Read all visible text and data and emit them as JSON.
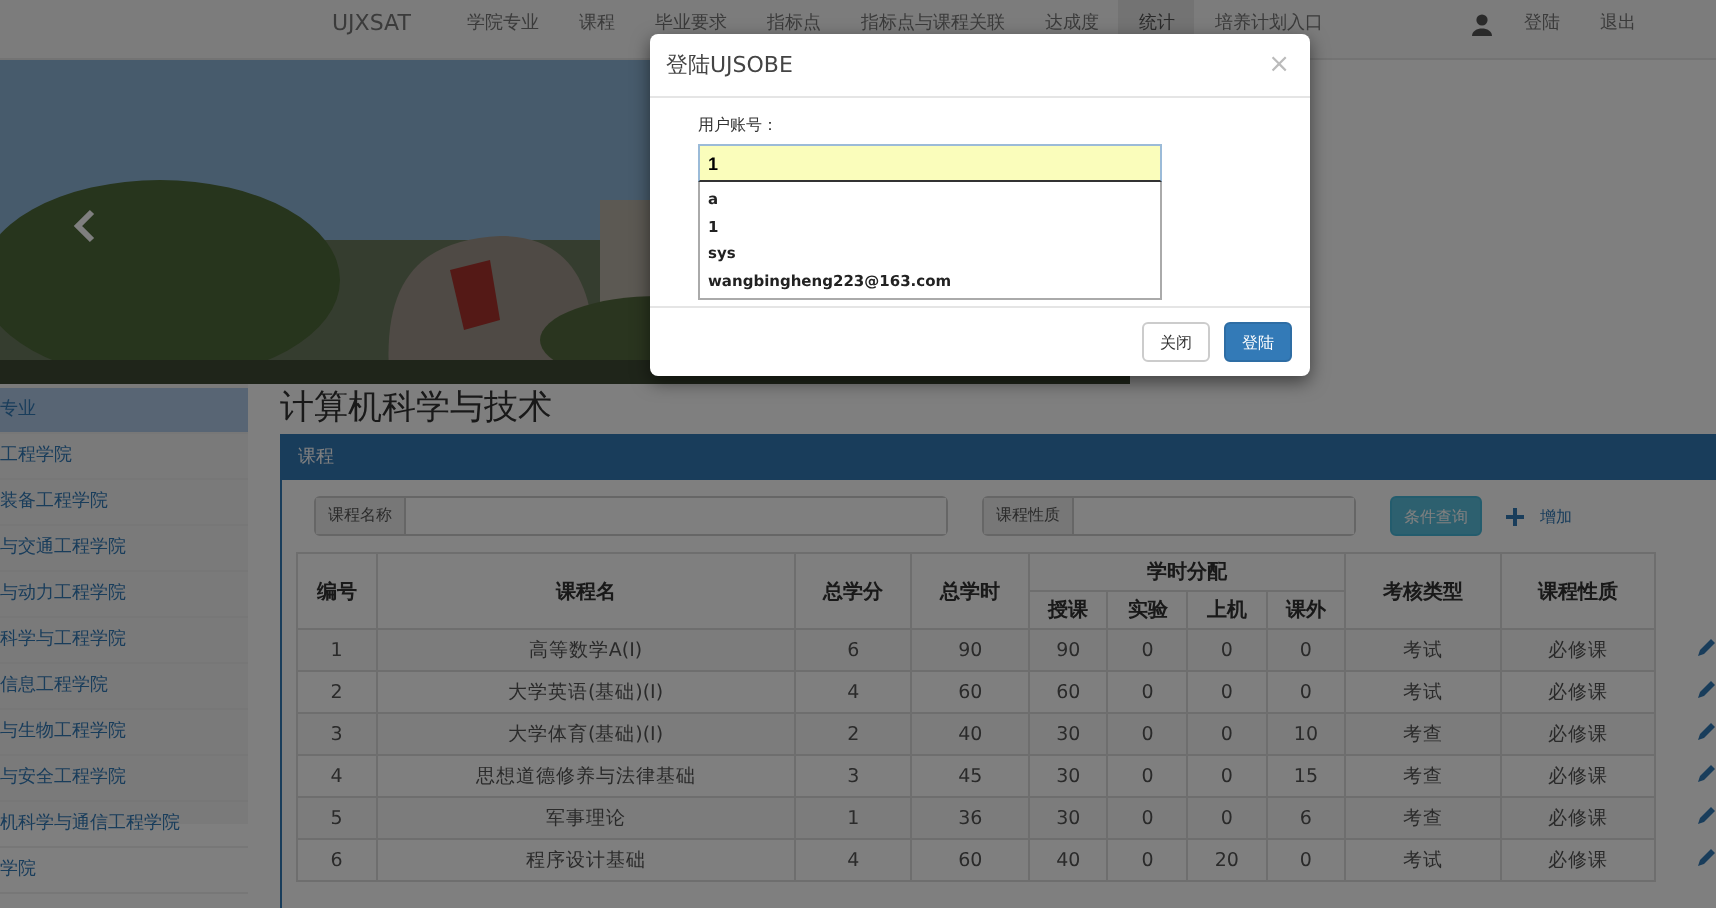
{
  "nav": {
    "brand": "UJXSAT",
    "items": [
      {
        "label": "学院专业",
        "selected": false
      },
      {
        "label": "课程",
        "selected": false
      },
      {
        "label": "毕业要求",
        "selected": false
      },
      {
        "label": "指标点",
        "selected": false
      },
      {
        "label": "指标点与课程关联",
        "selected": false
      },
      {
        "label": "达成度",
        "selected": false
      },
      {
        "label": "统计",
        "selected": true
      },
      {
        "label": "培养计划入口",
        "selected": false
      }
    ],
    "right": [
      "登陆",
      "退出"
    ]
  },
  "sidebar": {
    "items": [
      {
        "label": "专业",
        "selected": true
      },
      {
        "label": "工程学院",
        "selected": false
      },
      {
        "label": "装备工程学院",
        "selected": false
      },
      {
        "label": "与交通工程学院",
        "selected": false
      },
      {
        "label": "与动力工程学院",
        "selected": false
      },
      {
        "label": "科学与工程学院",
        "selected": false
      },
      {
        "label": "信息工程学院",
        "selected": false
      },
      {
        "label": "与生物工程学院",
        "selected": false
      },
      {
        "label": "与安全工程学院",
        "selected": false
      },
      {
        "label": "机科学与通信工程学院",
        "selected": false
      },
      {
        "label": "学院",
        "selected": false
      }
    ]
  },
  "page_title": "计算机科学与技术",
  "panel": {
    "title": "课程",
    "filters": [
      {
        "label": "课程名称"
      },
      {
        "label": "课程性质"
      }
    ],
    "search_button": "条件查询",
    "add_link": "增加"
  },
  "table": {
    "group_header": "学时分配",
    "columns": [
      {
        "label": "编号",
        "grouped": false
      },
      {
        "label": "课程名",
        "grouped": false
      },
      {
        "label": "总学分",
        "grouped": false
      },
      {
        "label": "总学时",
        "grouped": false
      },
      {
        "label": "授课",
        "grouped": true
      },
      {
        "label": "实验",
        "grouped": true
      },
      {
        "label": "上机",
        "grouped": true
      },
      {
        "label": "课外",
        "grouped": true
      },
      {
        "label": "考核类型",
        "grouped": false
      },
      {
        "label": "课程性质",
        "grouped": false
      }
    ],
    "rows": [
      [
        "1",
        "高等数学A(I)",
        "6",
        "90",
        "90",
        "0",
        "0",
        "0",
        "考试",
        "必修课"
      ],
      [
        "2",
        "大学英语(基础)(I)",
        "4",
        "60",
        "60",
        "0",
        "0",
        "0",
        "考试",
        "必修课"
      ],
      [
        "3",
        "大学体育(基础)(I)",
        "2",
        "40",
        "30",
        "0",
        "0",
        "10",
        "考查",
        "必修课"
      ],
      [
        "4",
        "思想道德修养与法律基础",
        "3",
        "45",
        "30",
        "0",
        "0",
        "15",
        "考查",
        "必修课"
      ],
      [
        "5",
        "军事理论",
        "1",
        "36",
        "30",
        "0",
        "0",
        "6",
        "考查",
        "必修课"
      ],
      [
        "6",
        "程序设计基础",
        "4",
        "60",
        "40",
        "0",
        "20",
        "0",
        "考试",
        "必修课"
      ]
    ]
  },
  "modal": {
    "title": "登陆UJSOBE",
    "close": "×",
    "field_label": "用户账号：",
    "field_value": "1",
    "suggestions": [
      "a",
      "1",
      "sys",
      "wangbingheng223@163.com"
    ],
    "buttons": [
      {
        "label": "关闭",
        "kind": "default"
      },
      {
        "label": "登陆",
        "kind": "primary"
      }
    ]
  }
}
